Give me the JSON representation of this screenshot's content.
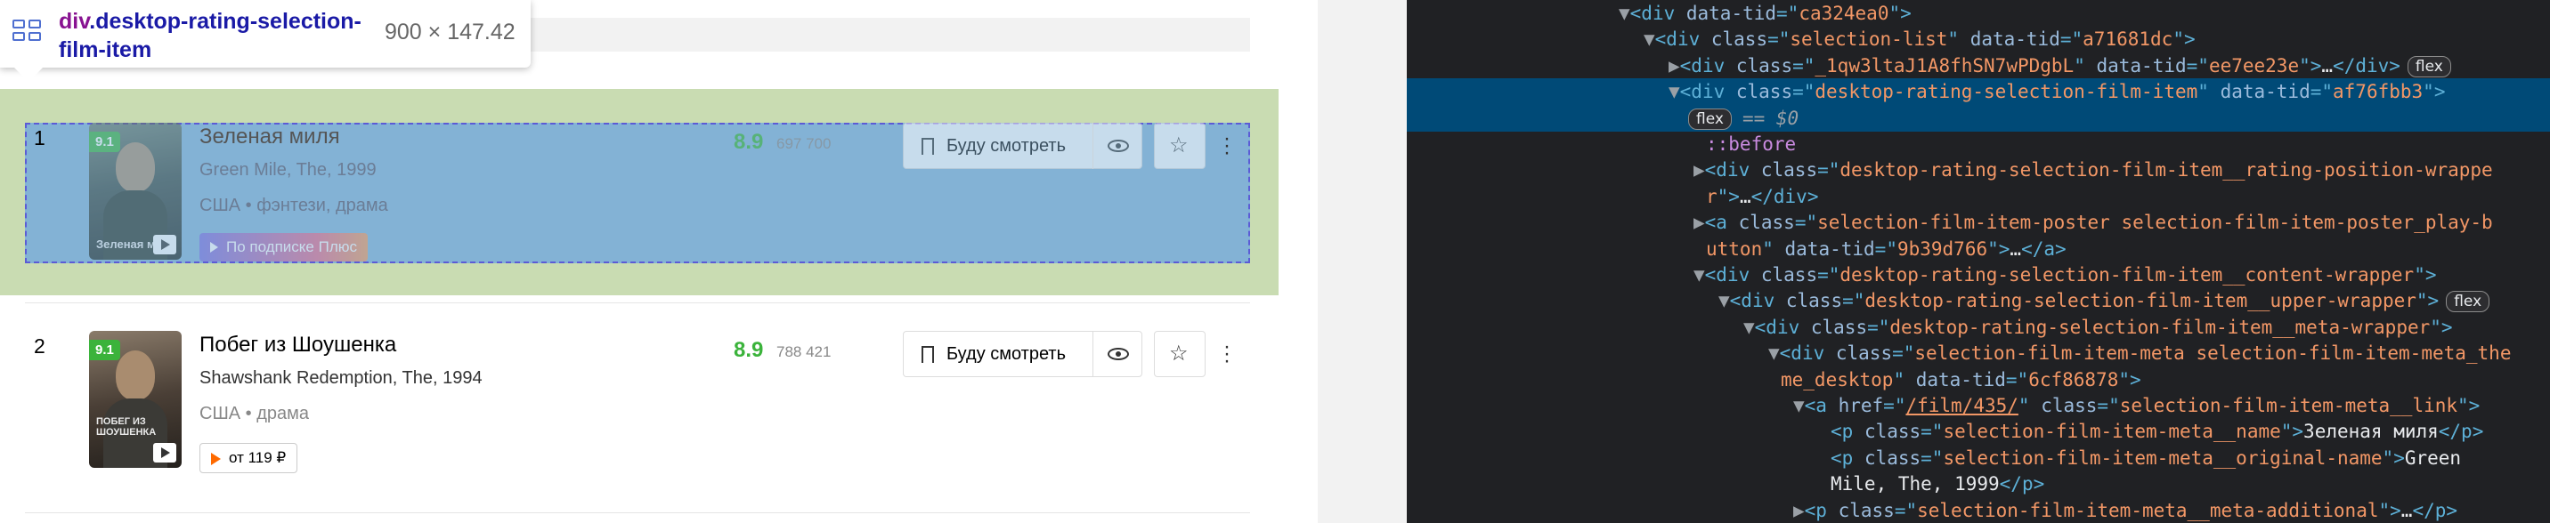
{
  "tooltip": {
    "element_tag": "div",
    "element_class": ".desktop-rating-selection-film-item",
    "size": "900 × 147.42"
  },
  "films": [
    {
      "rank": "1",
      "badge": "9.1",
      "poster_title": "Зеленая миля",
      "title": "Зеленая миля",
      "original": "Green Mile, The, 1999",
      "meta": "США • фэнтези, драма",
      "action_label": "По подписке Плюс",
      "score": "8.9",
      "votes": "697 700",
      "watch_label": "Буду смотреть"
    },
    {
      "rank": "2",
      "badge": "9.1",
      "poster_title": "ПОБЕГ ИЗ ШОУШЕНКА",
      "title": "Побег из Шоушенка",
      "original": "Shawshank Redemption, The, 1994",
      "meta": "США • драма",
      "action_label": "от 119 ₽",
      "score": "8.9",
      "votes": "788 421",
      "watch_label": "Буду смотреть"
    }
  ],
  "devtools": {
    "lines": [
      {
        "indent": 0,
        "tri": "▼",
        "parts": [
          [
            "tag",
            "<div "
          ],
          [
            "attr",
            "data-tid"
          ],
          [
            "tag",
            "=\""
          ],
          [
            "val",
            "ca324ea0"
          ],
          [
            "tag",
            "\">"
          ]
        ]
      },
      {
        "indent": 1,
        "tri": "▼",
        "parts": [
          [
            "tag",
            "<div "
          ],
          [
            "attr",
            "class"
          ],
          [
            "tag",
            "=\""
          ],
          [
            "val",
            "selection-list"
          ],
          [
            "tag",
            "\" "
          ],
          [
            "attr",
            "data-tid"
          ],
          [
            "tag",
            "=\""
          ],
          [
            "val",
            "a71681dc"
          ],
          [
            "tag",
            "\">"
          ]
        ]
      },
      {
        "indent": 2,
        "tri": "▶",
        "parts": [
          [
            "tag",
            "<div "
          ],
          [
            "attr",
            "class"
          ],
          [
            "tag",
            "=\""
          ],
          [
            "val",
            "_1qw3ltaJ1A8fhSN7wPDgbL"
          ],
          [
            "tag",
            "\" "
          ],
          [
            "attr",
            "data-tid"
          ],
          [
            "tag",
            "=\""
          ],
          [
            "val",
            "ee7ee23e"
          ],
          [
            "tag",
            "\">"
          ],
          [
            "txt",
            "…"
          ],
          [
            "tag",
            "</div>"
          ]
        ],
        "pill": "flex"
      },
      {
        "indent": 2,
        "tri": "▼",
        "sel": true,
        "parts": [
          [
            "tag",
            "<div "
          ],
          [
            "attr",
            "class"
          ],
          [
            "tag",
            "=\""
          ],
          [
            "val",
            "desktop-rating-selection-film-item"
          ],
          [
            "tag",
            "\" "
          ],
          [
            "attr",
            "data-tid"
          ],
          [
            "tag",
            "=\""
          ],
          [
            "val",
            "af76fbb3"
          ],
          [
            "tag",
            "\">"
          ]
        ]
      },
      {
        "indent": 2,
        "tri": "",
        "sel": true,
        "pill_only": "flex",
        "suffix": "== $0"
      },
      {
        "indent": 3,
        "tri": "",
        "parts": [
          [
            "pseudo",
            "::before"
          ]
        ]
      },
      {
        "indent": 3,
        "tri": "▶",
        "parts": [
          [
            "tag",
            "<div "
          ],
          [
            "attr",
            "class"
          ],
          [
            "tag",
            "=\""
          ],
          [
            "val",
            "desktop-rating-selection-film-item__rating-position-wrappe"
          ]
        ]
      },
      {
        "indent": 3,
        "tri": "",
        "parts": [
          [
            "val",
            "r"
          ],
          [
            "tag",
            "\">"
          ],
          [
            "txt",
            "…"
          ],
          [
            "tag",
            "</div>"
          ]
        ]
      },
      {
        "indent": 3,
        "tri": "▶",
        "parts": [
          [
            "tag",
            "<a "
          ],
          [
            "attr",
            "class"
          ],
          [
            "tag",
            "=\""
          ],
          [
            "val",
            "selection-film-item-poster selection-film-item-poster_play-b"
          ]
        ]
      },
      {
        "indent": 3,
        "tri": "",
        "parts": [
          [
            "val",
            "utton"
          ],
          [
            "tag",
            "\" "
          ],
          [
            "attr",
            "data-tid"
          ],
          [
            "tag",
            "=\""
          ],
          [
            "val",
            "9b39d766"
          ],
          [
            "tag",
            "\">"
          ],
          [
            "txt",
            "…"
          ],
          [
            "tag",
            "</a>"
          ]
        ]
      },
      {
        "indent": 3,
        "tri": "▼",
        "parts": [
          [
            "tag",
            "<div "
          ],
          [
            "attr",
            "class"
          ],
          [
            "tag",
            "=\""
          ],
          [
            "val",
            "desktop-rating-selection-film-item__content-wrapper"
          ],
          [
            "tag",
            "\">"
          ]
        ]
      },
      {
        "indent": 4,
        "tri": "▼",
        "parts": [
          [
            "tag",
            "<div "
          ],
          [
            "attr",
            "class"
          ],
          [
            "tag",
            "=\""
          ],
          [
            "val",
            "desktop-rating-selection-film-item__upper-wrapper"
          ],
          [
            "tag",
            "\">"
          ]
        ],
        "pill": "flex"
      },
      {
        "indent": 5,
        "tri": "▼",
        "parts": [
          [
            "tag",
            "<div "
          ],
          [
            "attr",
            "class"
          ],
          [
            "tag",
            "=\""
          ],
          [
            "val",
            "desktop-rating-selection-film-item__meta-wrapper"
          ],
          [
            "tag",
            "\">"
          ]
        ]
      },
      {
        "indent": 6,
        "tri": "▼",
        "parts": [
          [
            "tag",
            "<div "
          ],
          [
            "attr",
            "class"
          ],
          [
            "tag",
            "=\""
          ],
          [
            "val",
            "selection-film-item-meta selection-film-item-meta_the"
          ]
        ]
      },
      {
        "indent": 6,
        "tri": "",
        "parts": [
          [
            "val",
            "me_desktop"
          ],
          [
            "tag",
            "\" "
          ],
          [
            "attr",
            "data-tid"
          ],
          [
            "tag",
            "=\""
          ],
          [
            "val",
            "6cf86878"
          ],
          [
            "tag",
            "\">"
          ]
        ]
      },
      {
        "indent": 7,
        "tri": "▼",
        "parts": [
          [
            "tag",
            "<a "
          ],
          [
            "attr",
            "href"
          ],
          [
            "tag",
            "=\""
          ],
          [
            "link",
            "/film/435/"
          ],
          [
            "tag",
            "\" "
          ],
          [
            "attr",
            "class"
          ],
          [
            "tag",
            "=\""
          ],
          [
            "val",
            "selection-film-item-meta__link"
          ],
          [
            "tag",
            "\">"
          ]
        ]
      },
      {
        "indent": 8,
        "tri": "",
        "parts": [
          [
            "tag",
            "<p "
          ],
          [
            "attr",
            "class"
          ],
          [
            "tag",
            "=\""
          ],
          [
            "val",
            "selection-film-item-meta__name"
          ],
          [
            "tag",
            "\">"
          ],
          [
            "txt",
            "Зеленая миля"
          ],
          [
            "tag",
            "</p>"
          ]
        ]
      },
      {
        "indent": 8,
        "tri": "",
        "parts": [
          [
            "tag",
            "<p "
          ],
          [
            "attr",
            "class"
          ],
          [
            "tag",
            "=\""
          ],
          [
            "val",
            "selection-film-item-meta__original-name"
          ],
          [
            "tag",
            "\">"
          ],
          [
            "txt",
            "Green"
          ]
        ]
      },
      {
        "indent": 8,
        "tri": "",
        "parts": [
          [
            "txt",
            "Mile, The, 1999"
          ],
          [
            "tag",
            "</p>"
          ]
        ]
      },
      {
        "indent": 7,
        "tri": "▶",
        "parts": [
          [
            "tag",
            "<p "
          ],
          [
            "attr",
            "class"
          ],
          [
            "tag",
            "=\""
          ],
          [
            "val",
            "selection-film-item-meta__meta-additional"
          ],
          [
            "tag",
            "\">"
          ],
          [
            "txt",
            "…"
          ],
          [
            "tag",
            "</p>"
          ]
        ]
      }
    ],
    "gutter_ellipsis": "…"
  }
}
